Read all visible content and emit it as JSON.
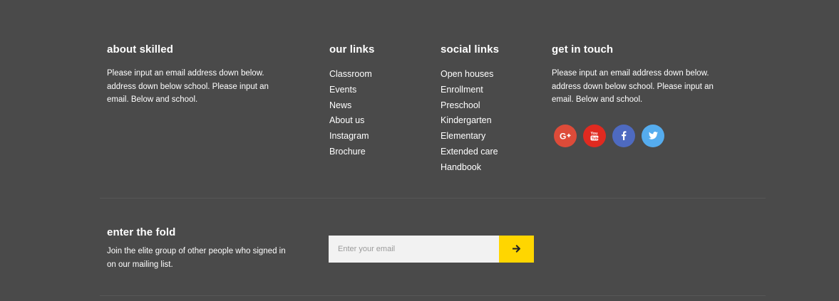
{
  "about": {
    "heading": "about skilled",
    "text": "Please input an email address down below. address down below school. Please input an email. Below and school."
  },
  "our_links": {
    "heading": "our links",
    "items": [
      "Classroom",
      "Events",
      "News",
      "About us",
      "Instagram",
      "Brochure"
    ]
  },
  "social_links": {
    "heading": "social links",
    "items": [
      "Open houses",
      "Enrollment",
      "Preschool",
      "Kindergarten",
      "Elementary",
      "Extended care",
      "Handbook"
    ]
  },
  "get_in_touch": {
    "heading": "get in touch",
    "text": "Please input an email address down below. address down below school. Please input an email. Below and school.",
    "social_icons": [
      {
        "icon": "google-plus-icon",
        "color": "#dd4b39"
      },
      {
        "icon": "youtube-icon",
        "color": "#e02a20"
      },
      {
        "icon": "facebook-icon",
        "color": "#4e6ac0"
      },
      {
        "icon": "twitter-icon",
        "color": "#55acee"
      }
    ]
  },
  "newsletter": {
    "heading": "enter the fold",
    "text": "Join the elite group of other people who signed in on our mailing list.",
    "placeholder": "Enter your email",
    "value": "",
    "submit_icon": "arrow-right-icon",
    "accent_color": "#ffd600"
  },
  "colors": {
    "background": "#4a4a4a",
    "divider": "#575757",
    "text": "#ffffff"
  }
}
